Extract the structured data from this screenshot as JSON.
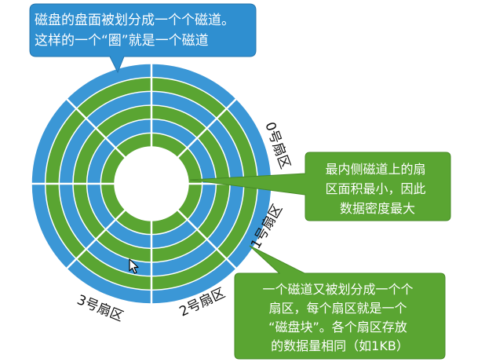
{
  "colors": {
    "track_blue": "#3b97d6",
    "track_green": "#5aa532",
    "callout_blue": "#2f8fd0",
    "callout_green": "#5aa532",
    "divider": "#ffffff"
  },
  "disk": {
    "track_count": 6,
    "sector_count": 8
  },
  "callouts": {
    "top": {
      "lines": [
        "磁盘的盘面被划分成一个个磁道。",
        "这样的一个“圈”就是一个磁道"
      ]
    },
    "right": {
      "lines": [
        "最内侧磁道上的扇",
        "区面积最小，因此",
        "数据密度最大"
      ]
    },
    "bottom": {
      "lines": [
        "一个磁道又被划分成一个个",
        "扇区，每个扇区就是一个",
        "“磁盘块”。各个扇区存放",
        "的数据量相同（如1KB）"
      ]
    }
  },
  "sector_labels": {
    "s0": "0号扇区",
    "s1": "1号扇区",
    "s2": "2号扇区",
    "s3": "3号扇区"
  },
  "icons": {
    "cursor": "mouse-pointer-icon"
  }
}
